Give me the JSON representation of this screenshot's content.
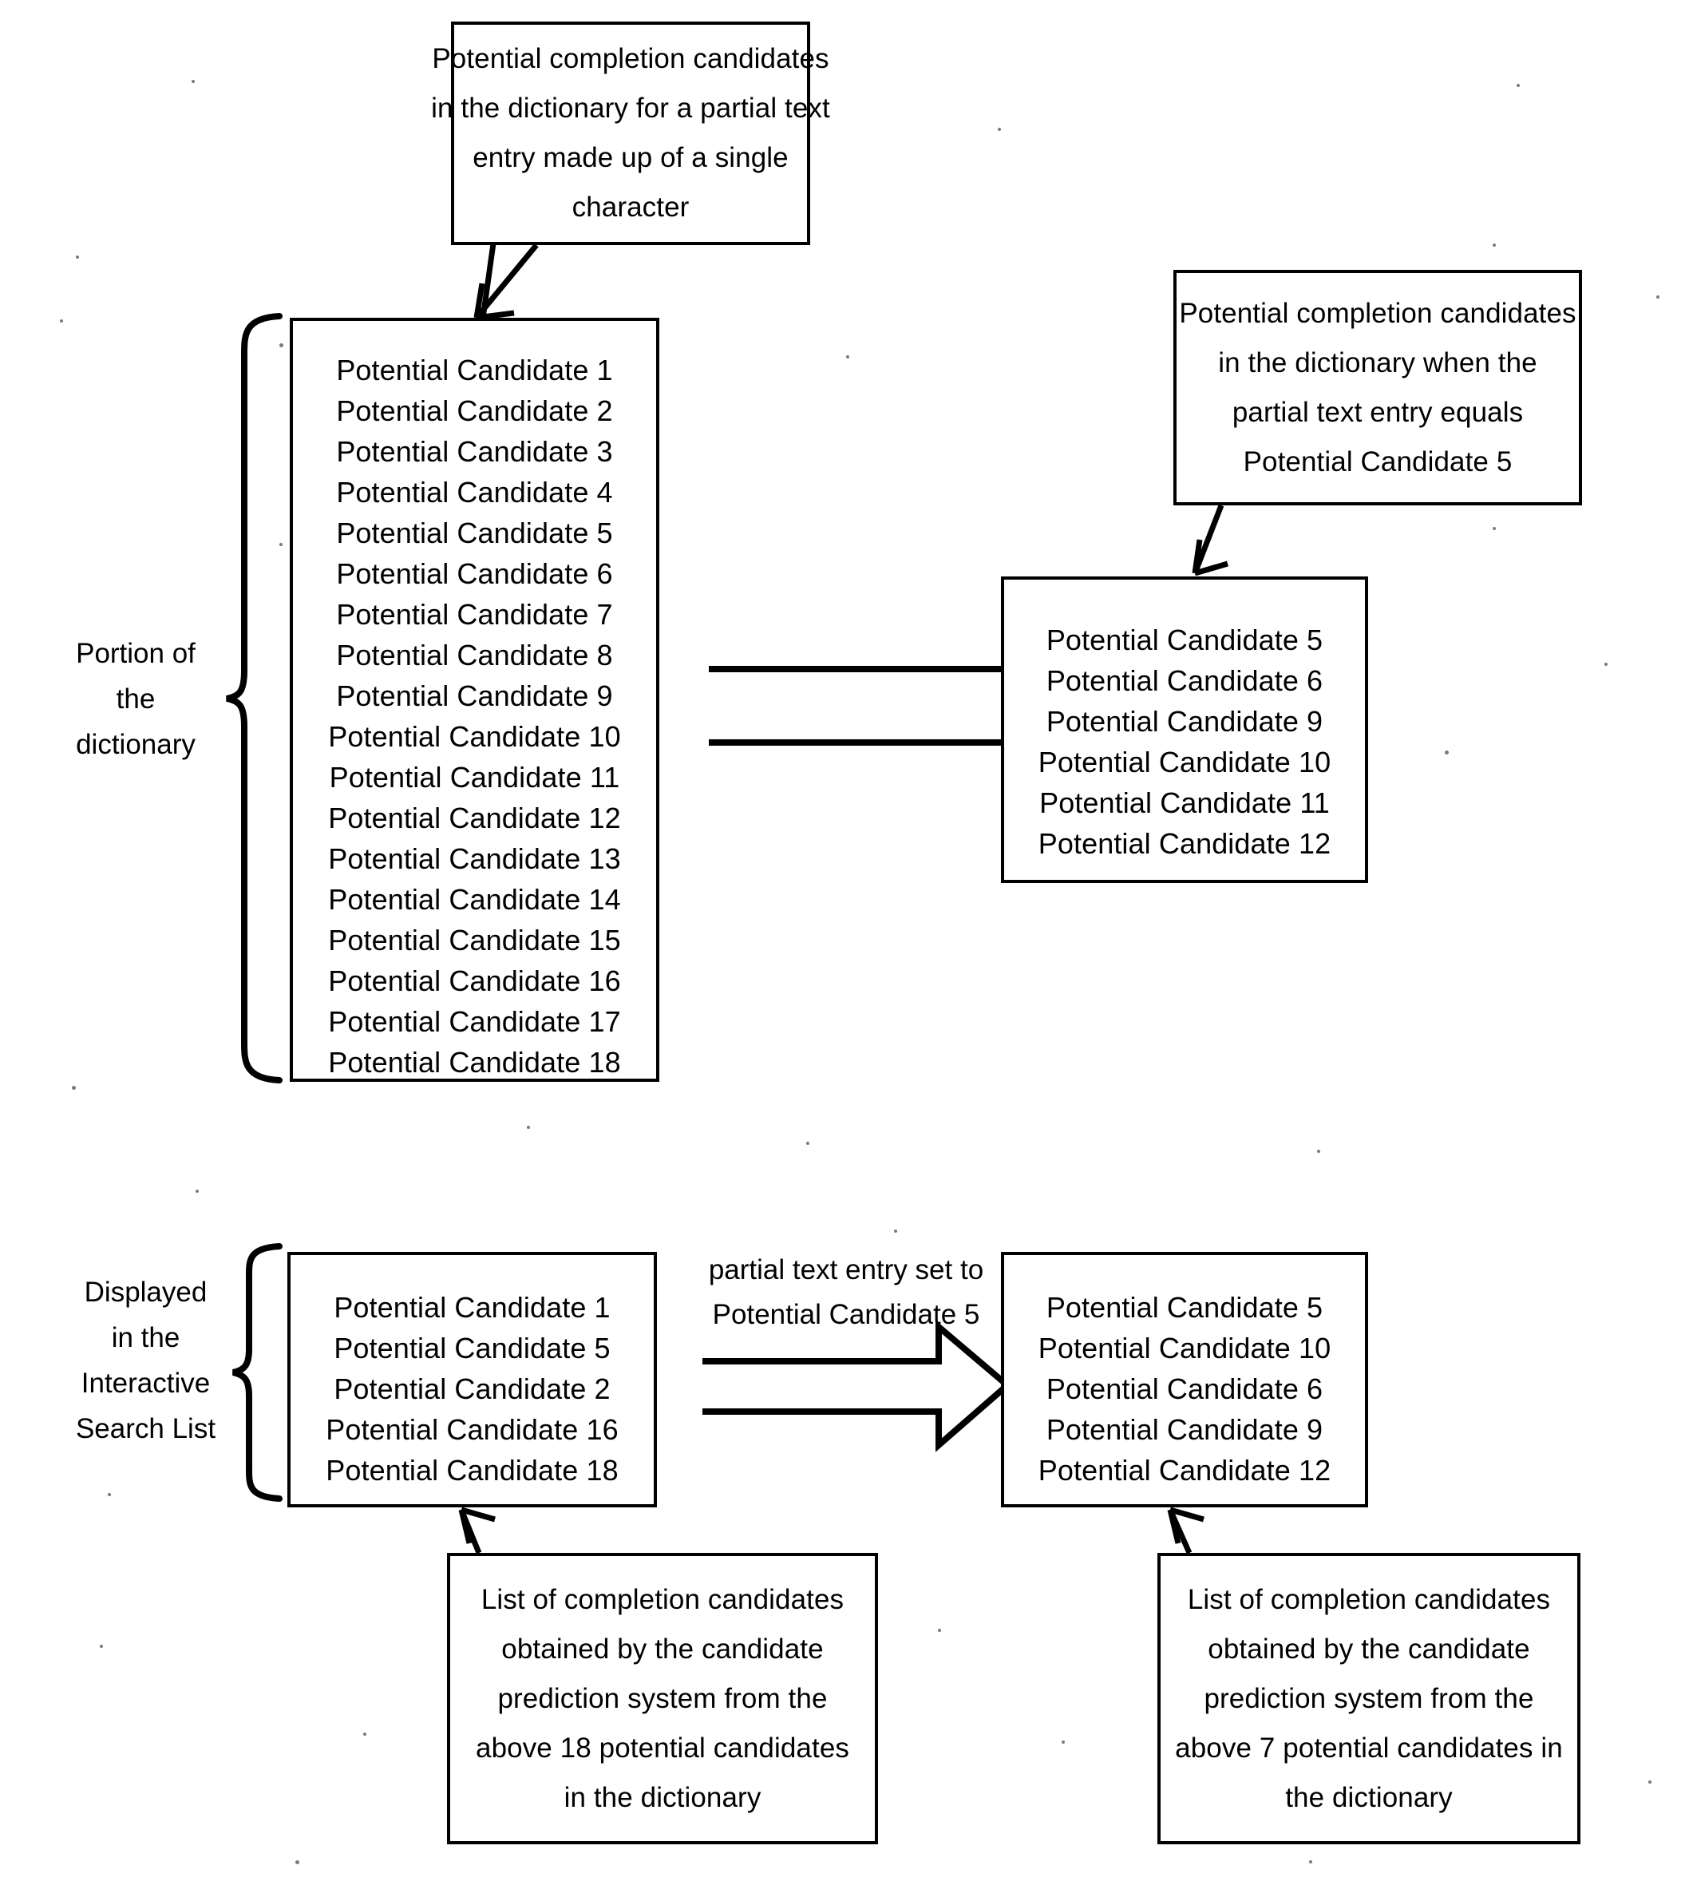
{
  "figure": {
    "title": "Candidate prediction dictionary filtering diagram"
  },
  "top_caption": {
    "lines": [
      "Potential completion candidates",
      "in the dictionary for a partial text",
      "entry made up of a single",
      "character"
    ]
  },
  "dictionary_label": {
    "lines": [
      "Portion of",
      "the",
      "dictionary"
    ]
  },
  "dictionary_box": {
    "items": [
      "Potential Candidate 1",
      "Potential Candidate 2",
      "Potential Candidate 3",
      "Potential Candidate 4",
      "Potential Candidate 5",
      "Potential Candidate 6",
      "Potential Candidate 7",
      "Potential Candidate 8",
      "Potential Candidate 9",
      "Potential Candidate 10",
      "Potential Candidate 11",
      "Potential Candidate 12",
      "Potential Candidate 13",
      "Potential Candidate 14",
      "Potential Candidate 15",
      "Potential Candidate 16",
      "Potential Candidate 17",
      "Potential Candidate 18"
    ]
  },
  "right_caption": {
    "lines": [
      "Potential completion candidates",
      "in the dictionary when the",
      "partial text entry equals",
      "Potential Candidate 5"
    ]
  },
  "filtered_box": {
    "items": [
      "Potential Candidate 5",
      "Potential Candidate 6",
      "Potential Candidate 9",
      "Potential Candidate 10",
      "Potential Candidate 11",
      "Potential Candidate 12"
    ]
  },
  "search_list_label": {
    "lines": [
      "Displayed",
      "in the",
      "Interactive",
      "Search List"
    ]
  },
  "search_list_box": {
    "items": [
      "Potential Candidate 1",
      "Potential Candidate 5",
      "Potential Candidate 2",
      "Potential Candidate 16",
      "Potential Candidate 18"
    ]
  },
  "transition_label": {
    "lines": [
      "partial text entry set to",
      "Potential Candidate 5"
    ]
  },
  "search_list_result_box": {
    "items": [
      "Potential Candidate 5",
      "Potential Candidate 10",
      "Potential Candidate 6",
      "Potential Candidate 9",
      "Potential Candidate 12"
    ]
  },
  "bottom_left_caption": {
    "lines": [
      "List of completion candidates",
      "obtained by the candidate",
      "prediction system from the",
      "above 18 potential candidates",
      "in the dictionary"
    ]
  },
  "bottom_right_caption": {
    "lines": [
      "List of completion candidates",
      "obtained by the candidate",
      "prediction system from the",
      "above 7 potential candidates in",
      "the dictionary"
    ]
  },
  "colors": {
    "ink": "#000000",
    "paper": "#ffffff"
  }
}
